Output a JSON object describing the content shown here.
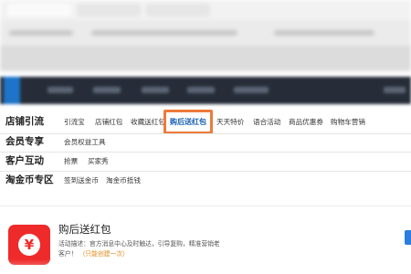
{
  "categories": [
    {
      "title": "店铺引流",
      "links": [
        "引流宝",
        "店铺红包",
        "收藏送红包",
        "购后送红包",
        "天天特价",
        "语合活动",
        "商品优惠券",
        "购物车营销"
      ],
      "active_index": 3
    },
    {
      "title": "会员专享",
      "links": [
        "会员权益工具"
      ]
    },
    {
      "title": "客户互动",
      "links": [
        "抢票",
        "买家秀"
      ]
    },
    {
      "title": "淘金币专区",
      "links": [
        "签到送金币",
        "淘金币抵钱"
      ]
    }
  ],
  "card": {
    "icon": "red-envelope-yen-icon",
    "icon_glyph": "¥",
    "title": "购后送红包",
    "description": "活动描述：官方消息中心及时触达，引导复购，精准营销老客户！",
    "note": "（只能创建一次）"
  },
  "colors": {
    "highlight_border": "#ee7a3a",
    "active_link": "#1a5fb4",
    "icon_red": "#ee2a2a",
    "nav_dark": "#262d38"
  }
}
